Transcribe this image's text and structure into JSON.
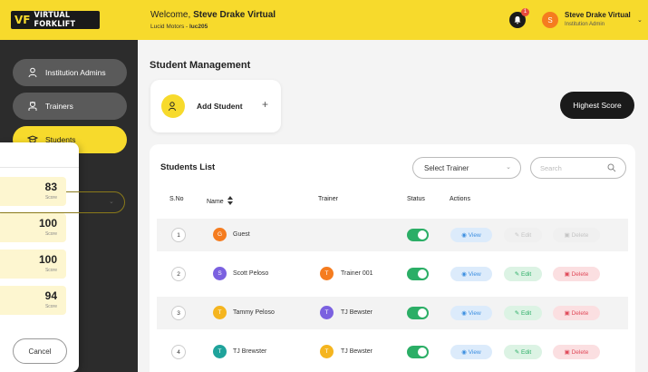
{
  "header": {
    "logo_mark": "VF",
    "logo_text": "VIRTUAL FORKLIFT",
    "welcome_prefix": "Welcome, ",
    "welcome_name": "Steve Drake Virtual",
    "org_name": "Lucid Motors - ",
    "org_code": "luc205",
    "notification_count": "1",
    "user_initial": "S",
    "user_name": "Steve Drake Virtual",
    "user_role": "Institution Admin"
  },
  "sidebar": {
    "items": [
      {
        "label": "Institution Admins",
        "icon": "admin-icon"
      },
      {
        "label": "Trainers",
        "icon": "trainer-icon"
      },
      {
        "label": "Students",
        "icon": "students-icon",
        "active": true
      }
    ]
  },
  "main": {
    "title": "Student Management",
    "add_student_label": "Add Student",
    "add_plus": "+",
    "highest_score_label": "Highest Score",
    "list_title": "Students List",
    "select_trainer": "Select Trainer",
    "search_placeholder": "Search",
    "columns": [
      "S.No",
      "Name",
      "Trainer",
      "Status",
      "Actions"
    ],
    "actions": {
      "view": "View",
      "edit": "Edit",
      "delete": "Delete"
    },
    "rows": [
      {
        "sno": "1",
        "initial": "G",
        "name": "Guest",
        "trainer_initial": "",
        "trainer": "",
        "status": "on",
        "editable": false
      },
      {
        "sno": "2",
        "initial": "S",
        "name": "Scott Peloso",
        "trainer_initial": "T",
        "trainer": "Trainer 001",
        "status": "on",
        "editable": true
      },
      {
        "sno": "3",
        "initial": "T",
        "name": "Tammy Peloso",
        "trainer_initial": "T",
        "trainer": "TJ Bewster",
        "status": "on",
        "editable": true
      },
      {
        "sno": "4",
        "initial": "T",
        "name": "TJ Brewster",
        "trainer_initial": "T",
        "trainer": "TJ Bewster",
        "status": "on",
        "editable": true
      }
    ]
  },
  "overlay": {
    "scores": [
      {
        "value": "83",
        "label": "Score"
      },
      {
        "value": "100",
        "label": "Score"
      },
      {
        "value": "100",
        "label": "Score"
      },
      {
        "value": "94",
        "label": "Score"
      }
    ],
    "cancel_label": "Cancel"
  },
  "colors": {
    "brand_yellow": "#f7da2c",
    "sidebar_bg": "#2c2c2c",
    "toggle_on": "#2bae66",
    "view_blue": "#3d8fe0",
    "delete_red": "#e04a5a"
  }
}
